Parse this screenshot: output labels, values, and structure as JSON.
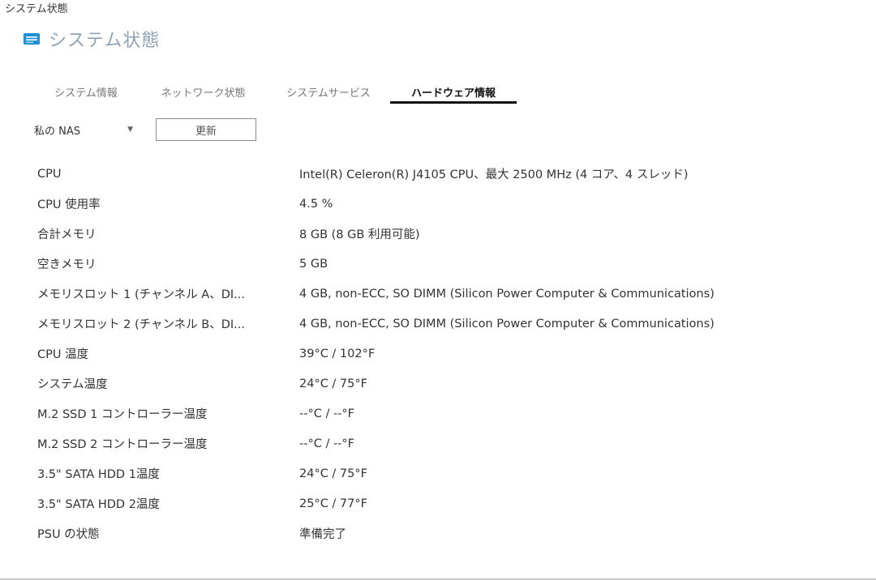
{
  "window": {
    "title": "システム状態"
  },
  "header": {
    "title": "システム状態",
    "icon": "monitor-icon",
    "accent_color": "#1f8fd6"
  },
  "tabs": [
    {
      "label": "システム情報",
      "active": false
    },
    {
      "label": "ネットワーク状態",
      "active": false
    },
    {
      "label": "システムサービス",
      "active": false
    },
    {
      "label": "ハードウェア情報",
      "active": true
    }
  ],
  "toolbar": {
    "device_selected": "私の NAS",
    "refresh_label": "更新"
  },
  "hardware_info": {
    "rows": [
      {
        "label": "CPU",
        "value": "Intel(R) Celeron(R) J4105 CPU、最大 2500 MHz (4 コア、4 スレッド)"
      },
      {
        "label": "CPU 使用率",
        "value": "4.5 %"
      },
      {
        "label": "合計メモリ",
        "value": "8 GB (8 GB 利用可能)"
      },
      {
        "label": "空きメモリ",
        "value": "5 GB"
      },
      {
        "label": "メモリスロット 1 (チャンネル A、DI...",
        "value": "4 GB, non-ECC, SO DIMM (Silicon Power Computer & Communications)"
      },
      {
        "label": "メモリスロット 2 (チャンネル B、DI...",
        "value": "4 GB, non-ECC, SO DIMM (Silicon Power Computer & Communications)"
      },
      {
        "label": "CPU 温度",
        "value": "39°C / 102°F"
      },
      {
        "label": "システム温度",
        "value": "24°C / 75°F"
      },
      {
        "label": "M.2 SSD 1 コントローラー温度",
        "value": "--°C / --°F"
      },
      {
        "label": "M.2 SSD 2 コントローラー温度",
        "value": "--°C / --°F"
      },
      {
        "label": "3.5\" SATA HDD 1温度",
        "value": "24°C / 75°F"
      },
      {
        "label": "3.5\" SATA HDD 2温度",
        "value": "25°C / 77°F"
      },
      {
        "label": "PSU の状態",
        "value": "準備完了"
      }
    ]
  }
}
